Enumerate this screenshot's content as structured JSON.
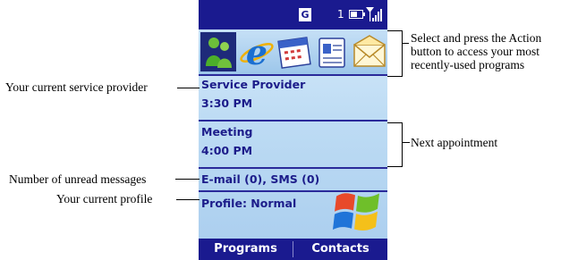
{
  "status_bar": {
    "network_badge": "G",
    "line_number": "1",
    "battery_level": 0.6,
    "battery_icon": "battery-icon",
    "signal_icon": "signal-strength-icon"
  },
  "recent_programs": [
    {
      "name": "msn-messenger-icon"
    },
    {
      "name": "internet-explorer-icon"
    },
    {
      "name": "calendar-icon"
    },
    {
      "name": "contacts-card-icon"
    },
    {
      "name": "messaging-envelope-icon"
    }
  ],
  "home": {
    "provider_name": "Service Provider",
    "current_time": "3:30 PM",
    "appointment_title": "Meeting",
    "appointment_time": "4:00 PM",
    "messages_summary": "E-mail (0), SMS (0)",
    "profile": "Profile: Normal",
    "logo_icon": "windows-flag-icon"
  },
  "softkeys": {
    "left": "Programs",
    "right": "Contacts"
  },
  "annotations": {
    "provider": "Your current service provider",
    "unread": "Number of unread messages",
    "profile": "Your current profile",
    "recent_line1": "Select and press the Action",
    "recent_line2": "button to access your most",
    "recent_line3": "recently-used programs",
    "appointment": "Next appointment"
  },
  "colors": {
    "bar_navy": "#1a1a8f",
    "text_navy": "#1c1c8a",
    "screen_light": "#d9ecfb",
    "screen_mid": "#a9cdee"
  }
}
